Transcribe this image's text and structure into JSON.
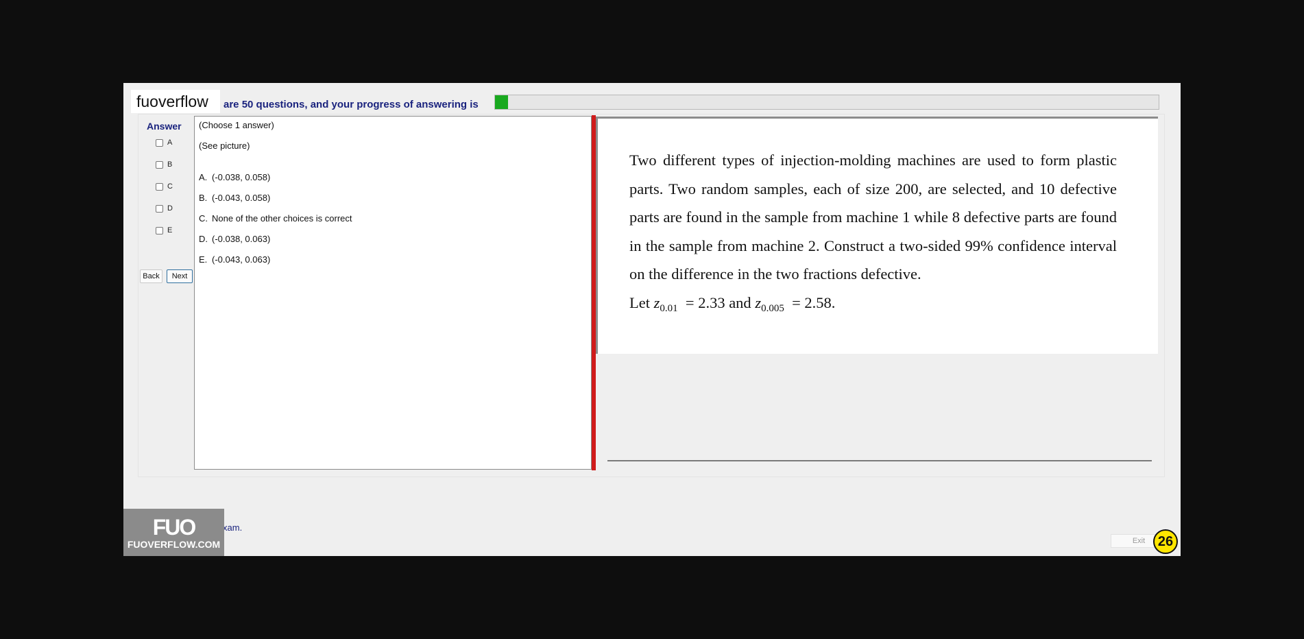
{
  "brand": "fuoverflow",
  "progress": {
    "text": "are 50 questions, and your progress of answering is",
    "fraction": 0.02,
    "fill_color": "#19a91f"
  },
  "answer_panel": {
    "title": "Answer",
    "options": [
      "A",
      "B",
      "C",
      "D",
      "E"
    ],
    "back_label": "Back",
    "next_label": "Next"
  },
  "question": {
    "instruction": "(Choose 1 answer)",
    "see_picture": "(See picture)",
    "choices": [
      {
        "letter": "A.",
        "text": "(-0.038, 0.058)"
      },
      {
        "letter": "B.",
        "text": "(-0.043, 0.058)"
      },
      {
        "letter": "C.",
        "text": "None of the other choices is correct"
      },
      {
        "letter": "D.",
        "text": "(-0.038, 0.063)"
      },
      {
        "letter": "E.",
        "text": "(-0.043, 0.063)"
      }
    ]
  },
  "problem": {
    "paragraph": "Two different types of injection-molding machines are used to form plastic parts. Two random samples, each of size 200, are selected, and 10 defective parts are found in the sample from machine 1 while 8 defective parts are found in the sample from machine 2. Construct a two-sided 99% confidence interval on the difference in the two fractions defective.",
    "let": "Let",
    "z1_symbol": "z",
    "z1_sub": "0.01",
    "z1_value": "=  2.33 and",
    "z2_symbol": "z",
    "z2_sub": "0.005",
    "z2_value": "=  2.58."
  },
  "footer": {
    "logo_mark": "FUO",
    "logo_site": "FUOVERFLOW.COM",
    "finish_label": "ant to finish the exam.",
    "exit_label": "Exit",
    "question_number": "26"
  },
  "colors": {
    "divider": "#cf1b1b",
    "label_blue": "#1a237e",
    "badge": "#ffe600"
  }
}
